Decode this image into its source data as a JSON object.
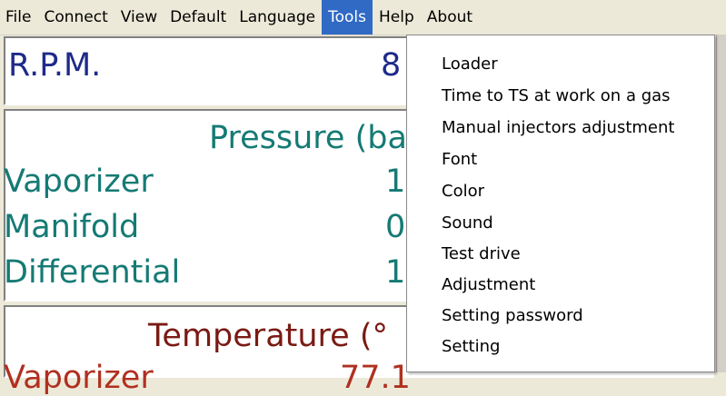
{
  "menubar": {
    "items": [
      {
        "label": "File"
      },
      {
        "label": "Connect"
      },
      {
        "label": "View"
      },
      {
        "label": "Default"
      },
      {
        "label": "Language"
      },
      {
        "label": "Tools"
      },
      {
        "label": "Help"
      },
      {
        "label": "About"
      }
    ]
  },
  "rpm": {
    "label": "R.P.M.",
    "value": "8"
  },
  "pressure": {
    "title": "Pressure (ba",
    "rows": [
      {
        "label": "Vaporizer",
        "value": "1."
      },
      {
        "label": "Manifold",
        "value": "0."
      },
      {
        "label": "Differential",
        "value": "1."
      }
    ]
  },
  "temperature": {
    "title": "Temperature (°",
    "row_label": "Vaporizer",
    "row_value": "77.1"
  },
  "tools_menu": {
    "items": [
      {
        "label": "Loader"
      },
      {
        "label": "Time to TS at work on a gas"
      },
      {
        "label": "Manual injectors adjustment"
      },
      {
        "label": "Font"
      },
      {
        "label": "Color"
      },
      {
        "label": "Sound"
      },
      {
        "label": "Test drive"
      },
      {
        "label": "Adjustment"
      },
      {
        "label": "Setting password"
      },
      {
        "label": "Setting"
      }
    ]
  },
  "colors": {
    "menu_highlight": "#316ac5",
    "rpm_text": "#1e2a8a",
    "pressure_text": "#157a74",
    "temperature_text": "#7a1a14"
  }
}
